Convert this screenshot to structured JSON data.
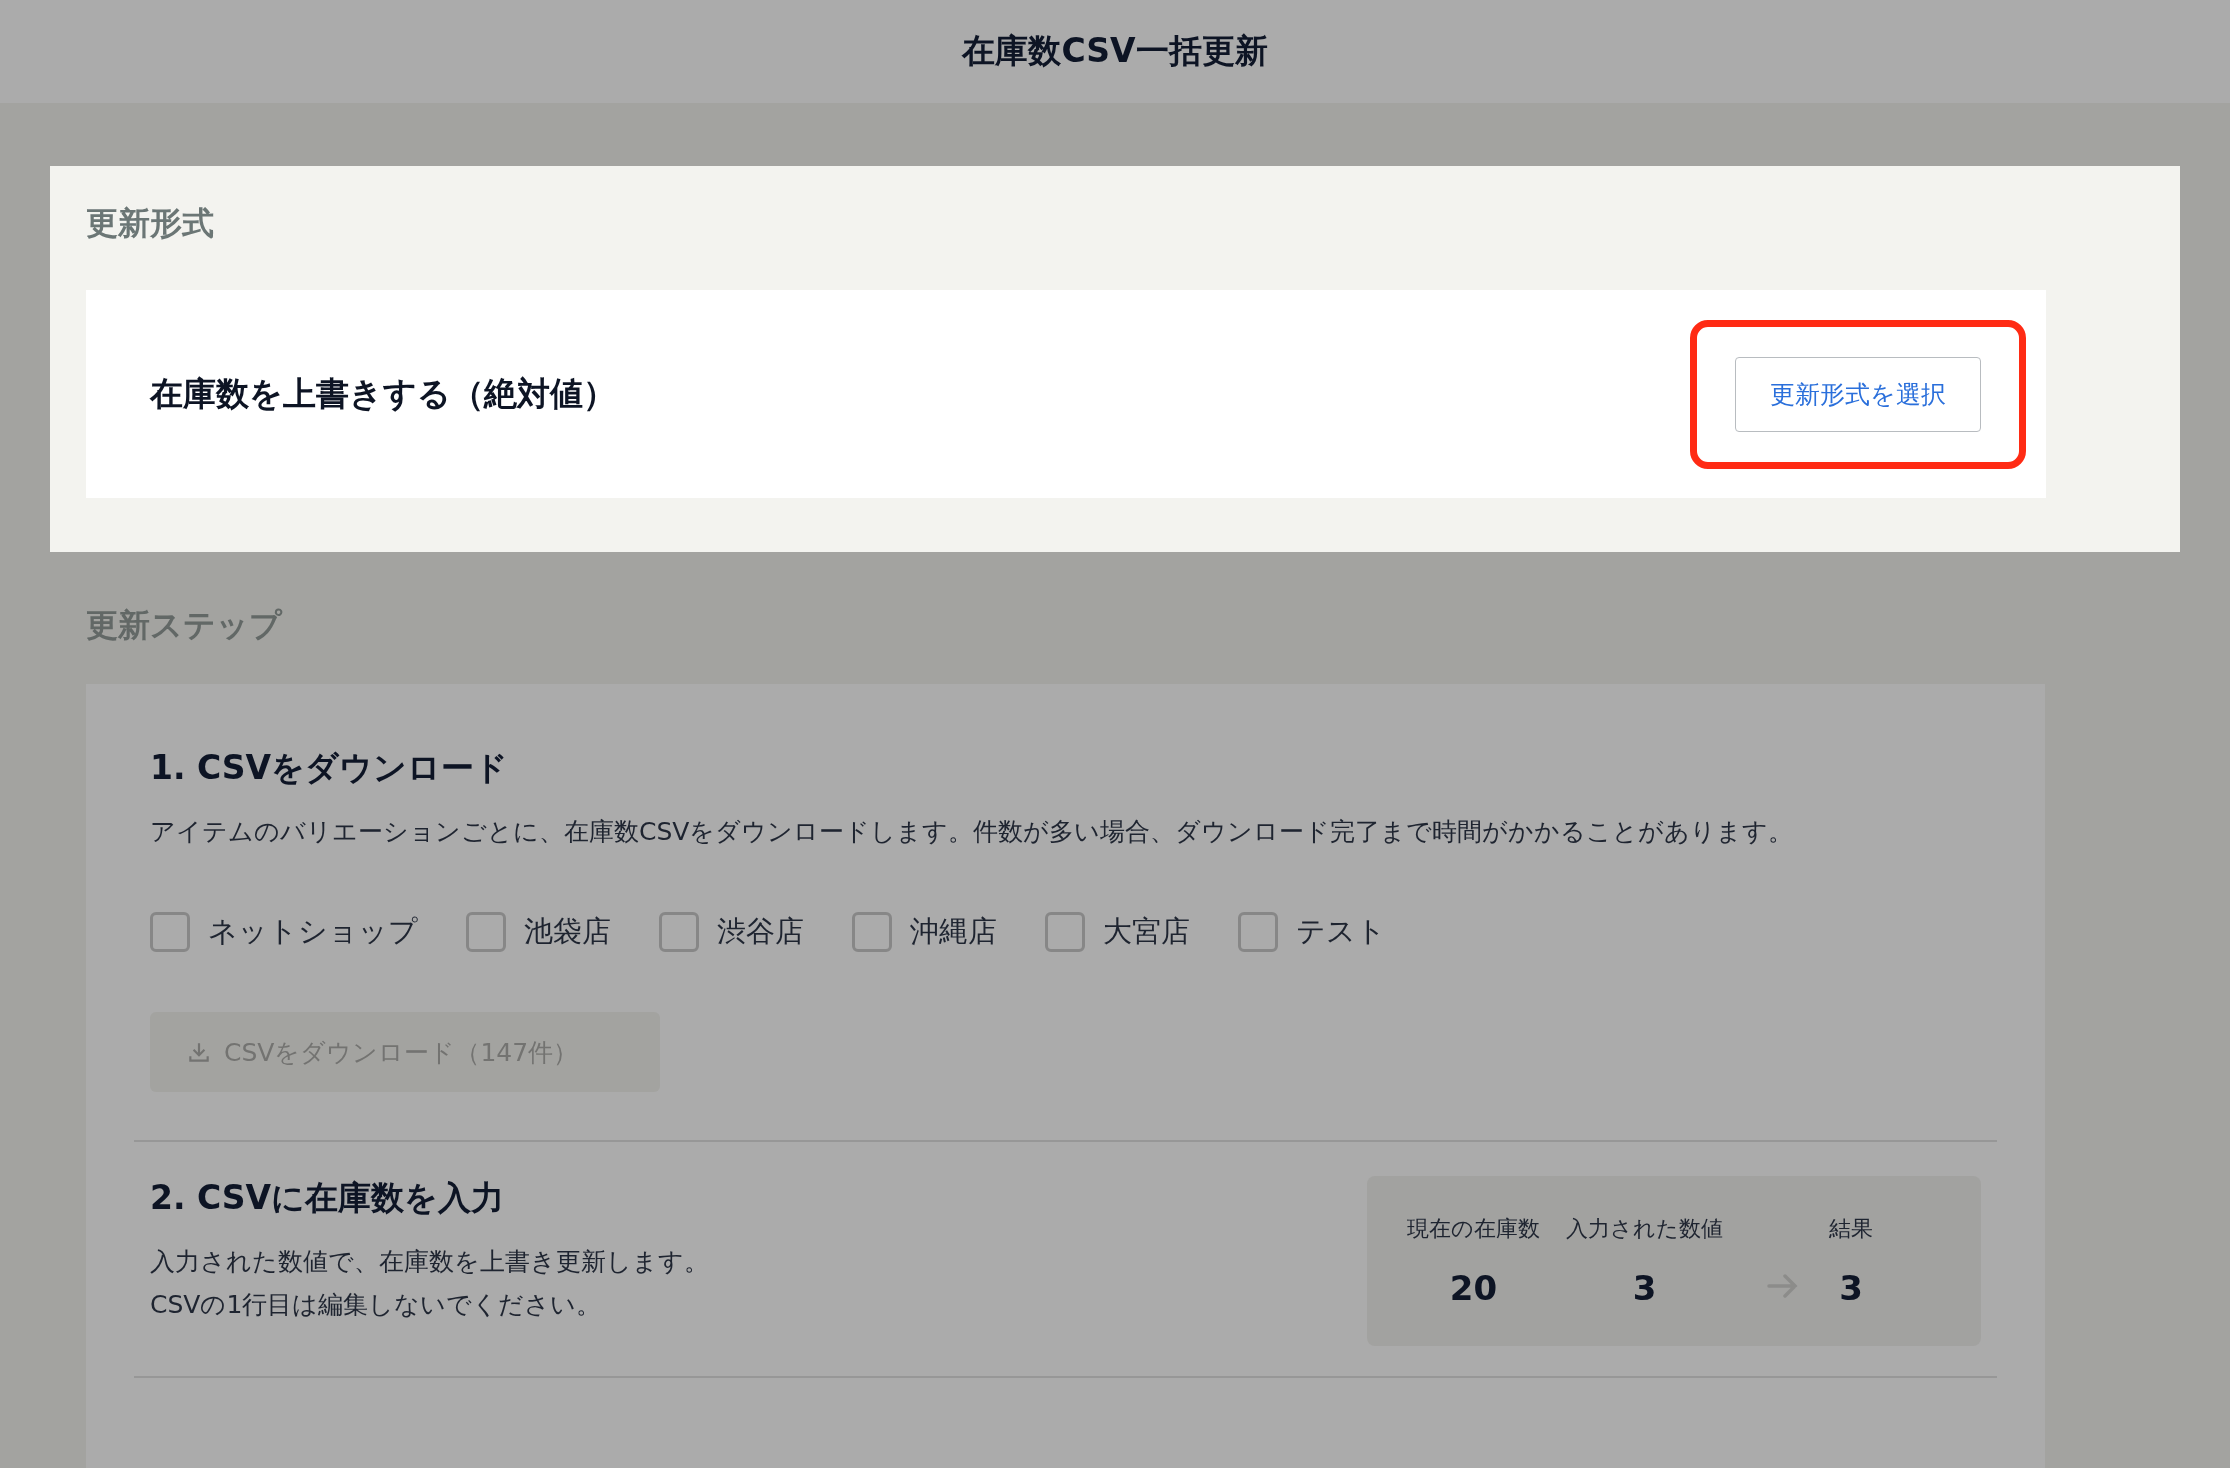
{
  "header": {
    "title": "在庫数CSV一括更新"
  },
  "format_section": {
    "heading": "更新形式",
    "highlighted": true,
    "current_value": "在庫数を上書きする（絶対値）",
    "button": {
      "label": "更新形式を選択",
      "highlighted": true
    }
  },
  "steps_heading": "更新ステップ",
  "steps": [
    {
      "kind": "download",
      "title": "1. CSVをダウンロード",
      "description": "アイテムのバリエーションごとに、在庫数CSVをダウンロードします。件数が多い場合、ダウンロード完了まで時間がかかることがあります。",
      "checkboxes": [
        {
          "label": "ネットショップ",
          "checked": false
        },
        {
          "label": "池袋店",
          "checked": false
        },
        {
          "label": "渋谷店",
          "checked": false
        },
        {
          "label": "沖縄店",
          "checked": false
        },
        {
          "label": "大宮店",
          "checked": false
        },
        {
          "label": "テスト",
          "checked": false
        }
      ],
      "button": {
        "label": "CSVをダウンロード（147件）",
        "disabled": true
      }
    },
    {
      "kind": "input",
      "title": "2. CSVに在庫数を入力",
      "description_lines": [
        "入力された数値で、在庫数を上書き更新します。",
        "CSVの1行目は編集しないでください。"
      ],
      "example": {
        "columns": [
          {
            "label": "現在の在庫数",
            "value": "20"
          },
          {
            "label": "入力された数値",
            "value": "3"
          }
        ],
        "result": {
          "label": "結果",
          "value": "3"
        }
      }
    }
  ]
}
